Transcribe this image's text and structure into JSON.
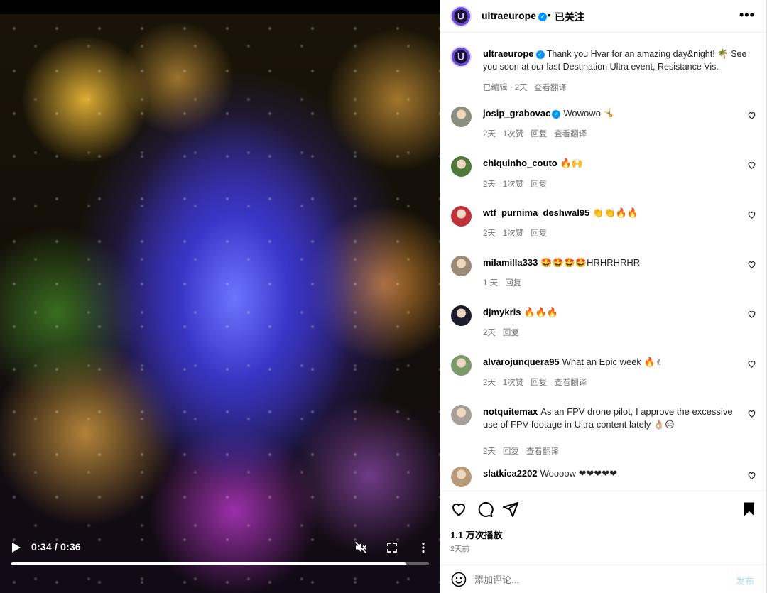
{
  "video": {
    "time": "0:34 / 0:36",
    "progress": 0.944
  },
  "header": {
    "avatar_letter": "U",
    "username": "ultraeurope",
    "dot": "•",
    "follow_label": "已关注",
    "more_label": "•••"
  },
  "caption": {
    "username": "ultraeurope",
    "text": "Thank you Hvar for an amazing day&night! 🌴 See you soon at our last Destination Ultra event, Resistance Vis.",
    "edited": "已编辑 · 2天",
    "translate": "查看翻译"
  },
  "comments": [
    {
      "username": "josip_grabovac",
      "verified": true,
      "text": "Wowowo 🤸",
      "time": "2天",
      "likes": "1次赞",
      "reply": "回复",
      "translate": "查看翻译",
      "avatar_color": "#8a8f80"
    },
    {
      "username": "chiquinho_couto",
      "verified": false,
      "text": "🔥🙌",
      "time": "2天",
      "likes": "1次赞",
      "reply": "回复",
      "translate": "",
      "avatar_color": "#4f7a3a"
    },
    {
      "username": "wtf_purnima_deshwal95",
      "verified": false,
      "text": "👏👏🔥🔥",
      "time": "2天",
      "likes": "1次赞",
      "reply": "回复",
      "translate": "",
      "avatar_color": "#c0303a"
    },
    {
      "username": "milamilla333",
      "verified": false,
      "text": "🤩🤩🤩🤩HRHRHRHR",
      "time": "1 天",
      "likes": "",
      "reply": "回复",
      "translate": "",
      "avatar_color": "#9a8a76"
    },
    {
      "username": "djmykris",
      "verified": false,
      "text": "🔥🔥🔥",
      "time": "2天",
      "likes": "",
      "reply": "回复",
      "translate": "",
      "avatar_color": "#1c1c2a"
    },
    {
      "username": "alvarojunquera95",
      "verified": false,
      "text": "What an Epic week 🔥✌",
      "time": "2天",
      "likes": "1次赞",
      "reply": "回复",
      "translate": "查看翻译",
      "avatar_color": "#7a9a6a"
    },
    {
      "username": "notquitemax",
      "verified": false,
      "text": "As an FPV drone pilot, I approve the excessive use of FPV footage in Ultra content lately 👌🏼😑",
      "time": "2天",
      "likes": "",
      "reply": "回复",
      "translate": "查看翻译",
      "avatar_color": "#a8a098"
    },
    {
      "username": "slatkica2202",
      "verified": false,
      "text": "Woooow ❤❤❤❤❤",
      "time": "",
      "likes": "",
      "reply": "",
      "translate": "",
      "avatar_color": "#b89a78"
    }
  ],
  "actions": {
    "views": "1.1 万次播放",
    "date": "2天前"
  },
  "comment_box": {
    "placeholder": "添加评论...",
    "post_label": "发布"
  },
  "colors": {
    "verified_blue": "#0095f6",
    "meta_gray": "#737373",
    "post_disabled": "#b2dffc"
  }
}
